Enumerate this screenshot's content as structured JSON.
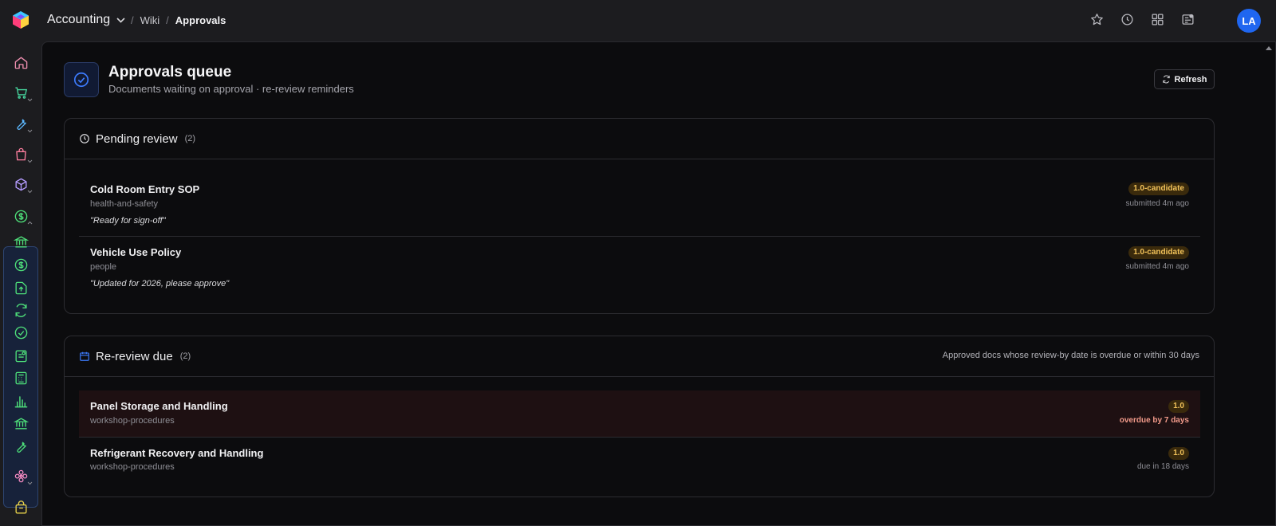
{
  "topbar": {
    "workspace": "Accounting",
    "breadcrumbs": [
      {
        "sep": "/",
        "label": "Wiki"
      },
      {
        "sep": "/",
        "label": "Approvals"
      }
    ],
    "icons": [
      "star-icon",
      "clock-icon",
      "grid-icon",
      "inbox-icon"
    ],
    "avatar_initials": "LA"
  },
  "rail": {
    "items": [
      "home-icon",
      "cart-icon",
      "wrench-icon",
      "bag-icon",
      "boxes-icon",
      "dollar-icon",
      "bank-icon",
      "dollar-icon",
      "upload-icon",
      "refresh-icon",
      "check-icon",
      "receipt-icon",
      "calculator-icon",
      "bar-chart-icon",
      "bank-icon",
      "wrench-icon",
      "flower-icon",
      "box-icon"
    ]
  },
  "header": {
    "title": "Approvals queue",
    "subtitle": "Documents waiting on approval · re-review reminders",
    "refresh_label": "Refresh"
  },
  "pending": {
    "title": "Pending review",
    "count": "(2)",
    "items": [
      {
        "title": "Cold Room Entry SOP",
        "tag": "health-and-safety",
        "quote": "\"Ready for sign-off\"",
        "badge": "1.0-candidate",
        "meta": "submitted 4m ago"
      },
      {
        "title": "Vehicle Use Policy",
        "tag": "people",
        "quote": "\"Updated for 2026, please approve\"",
        "badge": "1.0-candidate",
        "meta": "submitted 4m ago"
      }
    ]
  },
  "rereview": {
    "title": "Re-review due",
    "count": "(2)",
    "note": "Approved docs whose review-by date is overdue or within 30 days",
    "items": [
      {
        "title": "Panel Storage and Handling",
        "tag": "workshop-procedures",
        "badge": "1.0",
        "meta": "overdue by 7 days",
        "status": "overdue"
      },
      {
        "title": "Refrigerant Recovery and Handling",
        "tag": "workshop-procedures",
        "badge": "1.0",
        "meta": "due in 18 days",
        "status": "due"
      }
    ]
  },
  "colors": {
    "accent": "#1f66f0",
    "finance_group": "#17223a",
    "badge_text": "#f3c35a",
    "overdue_row": "#1e1012",
    "overdue_text": "#f29a8a"
  }
}
